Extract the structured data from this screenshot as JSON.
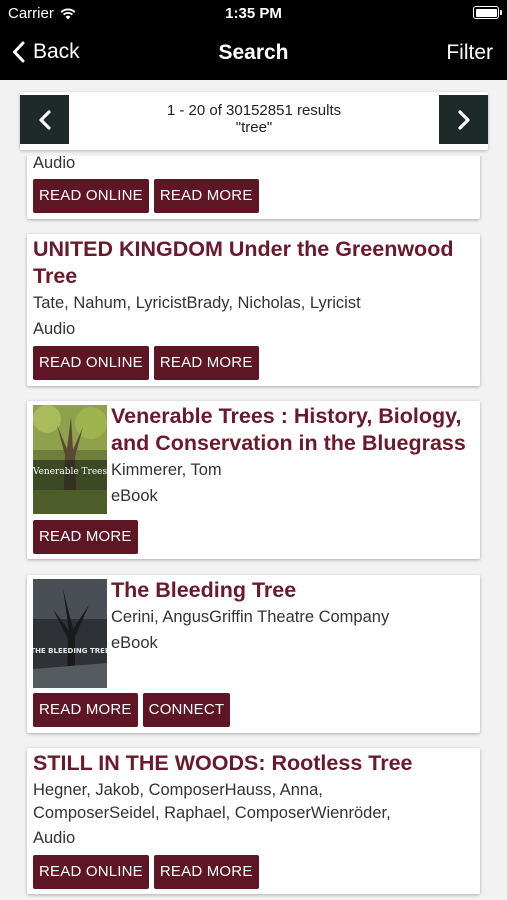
{
  "status_bar": {
    "carrier": "Carrier",
    "time": "1:35 PM"
  },
  "nav": {
    "back_label": "Back",
    "title": "Search",
    "filter_label": "Filter"
  },
  "pager": {
    "range": "1 - 20 of 30152851 results",
    "query": "\"tree\""
  },
  "results": [
    {
      "title": "",
      "lines": [
        "Audio"
      ],
      "buttons": [
        "READ ONLINE",
        "READ MORE"
      ]
    },
    {
      "title": "UNITED KINGDOM Under the Greenwood Tree",
      "lines": [
        "Tate, Nahum, LyricistBrady, Nicholas, Lyricist",
        "Audio"
      ],
      "buttons": [
        "READ ONLINE",
        "READ MORE"
      ]
    },
    {
      "title": "Venerable Trees : History, Biology, and Conservation in the Bluegrass",
      "lines": [
        "Kimmerer, Tom",
        "eBook"
      ],
      "buttons": [
        "READ MORE"
      ],
      "cover_text": "Venerable Trees"
    },
    {
      "title": "The Bleeding Tree",
      "lines": [
        "Cerini, AngusGriffin Theatre Company",
        "eBook"
      ],
      "buttons": [
        "READ MORE",
        "CONNECT"
      ],
      "cover_text": "THE BLEEDING TREE"
    },
    {
      "title": "STILL IN THE WOODS: Rootless Tree",
      "lines": [
        "Hegner, Jakob, ComposerHauss, Anna,",
        "ComposerSeidel, Raphael, ComposerWienröder,",
        "Audio"
      ],
      "buttons": [
        "READ ONLINE",
        "READ MORE"
      ]
    }
  ],
  "colors": {
    "title": "#6a1a2c",
    "button": "#5e1624",
    "pager_arrow": "#1d2a27",
    "bar": "#000000"
  }
}
